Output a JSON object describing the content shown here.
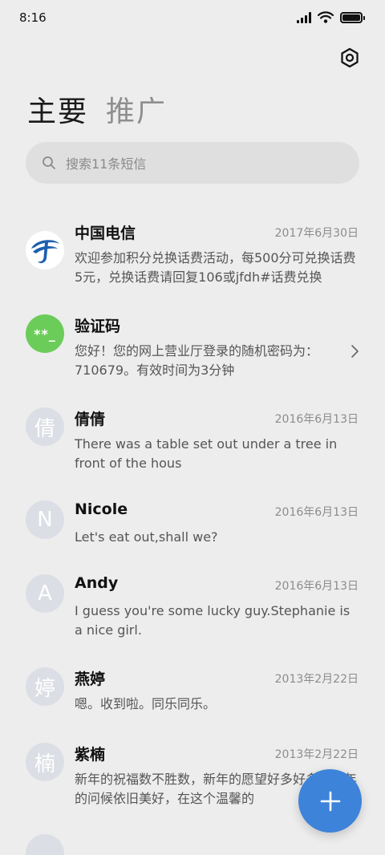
{
  "status_bar": {
    "time": "8:16"
  },
  "tabs": [
    {
      "label": "主要",
      "active": true
    },
    {
      "label": "推广",
      "active": false
    }
  ],
  "search": {
    "placeholder": "搜索11条短信"
  },
  "messages": [
    {
      "sender": "中国电信",
      "date": "2017年6月30日",
      "preview": "欢迎参加积分兑换话费活动，每500分可兑换话费5元，兑换话费请回复106或jfdh#话费兑换"
    },
    {
      "sender": "验证码",
      "date": "",
      "preview": "您好！您的网上营业厅登录的随机密码为：710679。有效时间为3分钟",
      "avatar_text": "**_"
    },
    {
      "sender": "倩倩",
      "date": "2016年6月13日",
      "preview": "There was a table set out under a tree in front of the hous",
      "avatar_text": "倩"
    },
    {
      "sender": "Nicole",
      "date": "2016年6月13日",
      "preview": "Let's eat out,shall we?",
      "avatar_text": "N"
    },
    {
      "sender": "Andy",
      "date": "2016年6月13日",
      "preview": "I guess you're some lucky guy.Stephanie is a nice girl.",
      "avatar_text": "A"
    },
    {
      "sender": "燕婷",
      "date": "2013年2月22日",
      "preview": "嗯。收到啦。同乐同乐。",
      "avatar_text": "婷"
    },
    {
      "sender": "紫楠",
      "date": "2013年2月22日",
      "preview": "新年的祝福数不胜数，新年的愿望好多好多，新年的问候依旧美好，在这个温馨的",
      "avatar_text": "楠"
    }
  ],
  "colors": {
    "fab": "#3d83d9",
    "verification_avatar": "#6ccc5a",
    "telecom_blue": "#1d5fae"
  },
  "icons": {
    "settings": "hexagon-settings-icon",
    "search": "search-icon",
    "fab": "plus-icon",
    "chevron": "chevron-right-icon"
  }
}
